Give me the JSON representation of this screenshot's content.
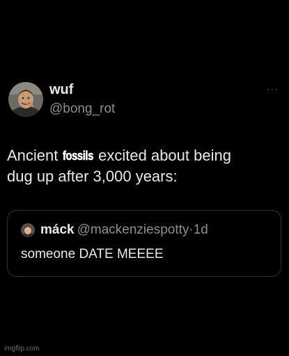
{
  "post": {
    "author": {
      "display_name": "wuf",
      "handle": "@bong_rot",
      "avatar_icon": "profile-photo-icon"
    },
    "more_menu_label": "···",
    "text": {
      "line1_before": "Ancient ",
      "overlay_word": "fossils",
      "line1_after": " excited about being",
      "line2": "dug up after 3,000 years:"
    },
    "quote": {
      "display_name": "máck",
      "handle": "@mackenziespotty",
      "separator": "·",
      "time": "1d",
      "text": "someone DATE MEEEE",
      "avatar_icon": "profile-photo-icon"
    }
  },
  "watermark": "imgflip.com",
  "colors": {
    "background": "#000000",
    "primary_text": "#e7e9ea",
    "secondary_text": "#8b8f94",
    "border": "#2f3336"
  }
}
